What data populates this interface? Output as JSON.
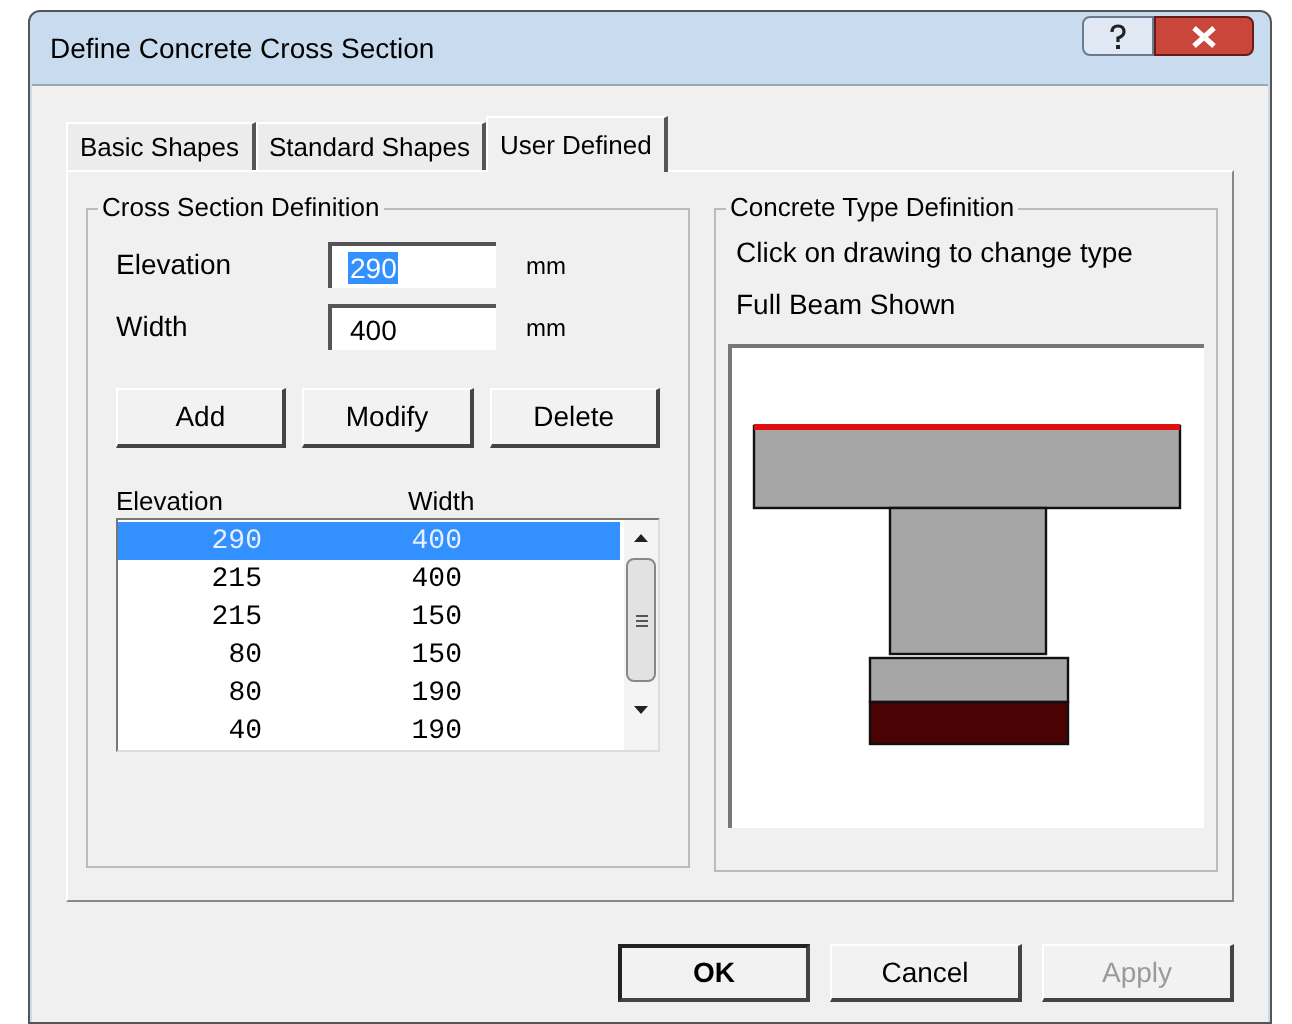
{
  "window": {
    "title": "Define Concrete Cross Section"
  },
  "tabs": [
    {
      "label": "Basic Shapes",
      "selected": false
    },
    {
      "label": "Standard Shapes",
      "selected": false
    },
    {
      "label": "User Defined",
      "selected": true
    }
  ],
  "cross_section_definition": {
    "title": "Cross Section Definition",
    "fields": [
      {
        "label": "Elevation",
        "value": "290",
        "unit": "mm",
        "selected": true
      },
      {
        "label": "Width",
        "value": "400",
        "unit": "mm",
        "selected": false
      }
    ],
    "buttons": [
      "Add",
      "Modify",
      "Delete"
    ],
    "list": {
      "columns": [
        "Elevation",
        "Width"
      ],
      "rows": [
        {
          "cells": [
            "290",
            "400"
          ],
          "selected": true
        },
        {
          "cells": [
            "215",
            "400"
          ],
          "selected": false
        },
        {
          "cells": [
            "215",
            "150"
          ],
          "selected": false
        },
        {
          "cells": [
            "80",
            "150"
          ],
          "selected": false
        },
        {
          "cells": [
            "80",
            "190"
          ],
          "selected": false
        },
        {
          "cells": [
            "40",
            "190"
          ],
          "selected": false
        }
      ]
    }
  },
  "concrete_type_definition": {
    "title": "Concrete Type Definition",
    "hints": [
      "Click on drawing to change type",
      "Full Beam Shown"
    ]
  },
  "buttons": [
    {
      "label": "OK",
      "disabled": false,
      "default": true
    },
    {
      "label": "Cancel",
      "disabled": false,
      "default": false
    },
    {
      "label": "Apply",
      "disabled": true,
      "default": false
    }
  ]
}
